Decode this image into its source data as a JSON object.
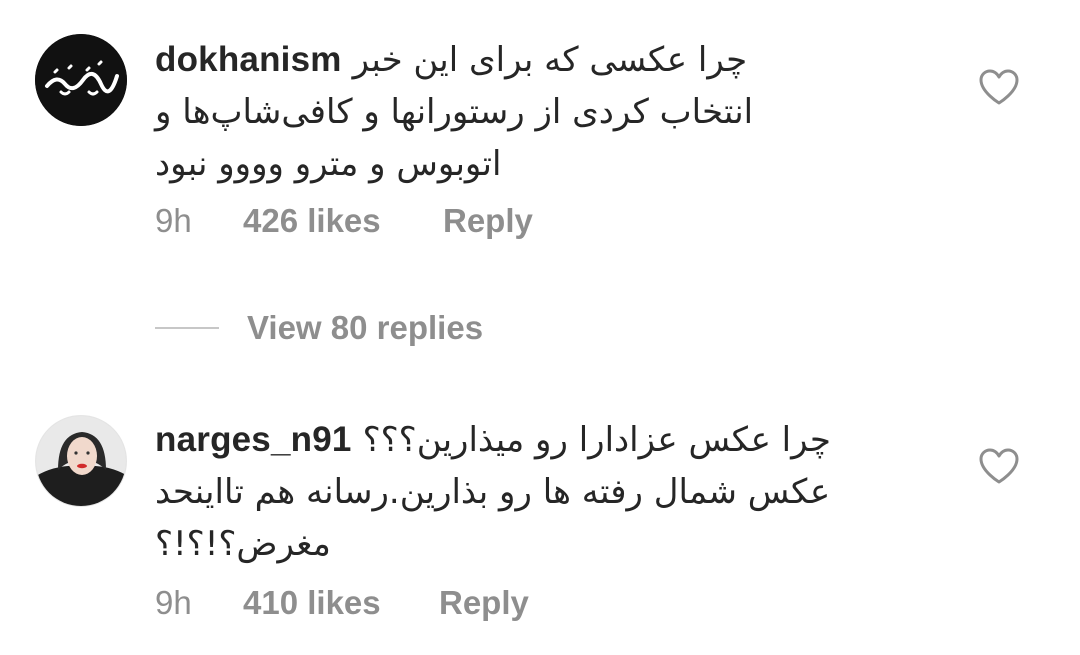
{
  "comments": [
    {
      "username": "dokhanism",
      "text": "چرا عکسی که برای این خبر انتخاب کردی از رستورانها و کافی‌شاپ‌ها و اتوبوس و مترو وووو نبود",
      "avatar_text": "دخانیسم",
      "time": "9h",
      "likes": "426 likes",
      "reply_label": "Reply",
      "like_icon": "heart-outline-icon"
    },
    {
      "username": "narges_n91",
      "text": "چرا عکس عزادارا رو میذارین؟؟؟ عکس شمال رفته ها رو بذارین.رسانه هم تااینحد مغرض؟!؟!؟",
      "time": "9h",
      "likes": "410 likes",
      "reply_label": "Reply",
      "like_icon": "heart-outline-icon"
    }
  ],
  "view_replies": {
    "label": "View 80 replies"
  }
}
